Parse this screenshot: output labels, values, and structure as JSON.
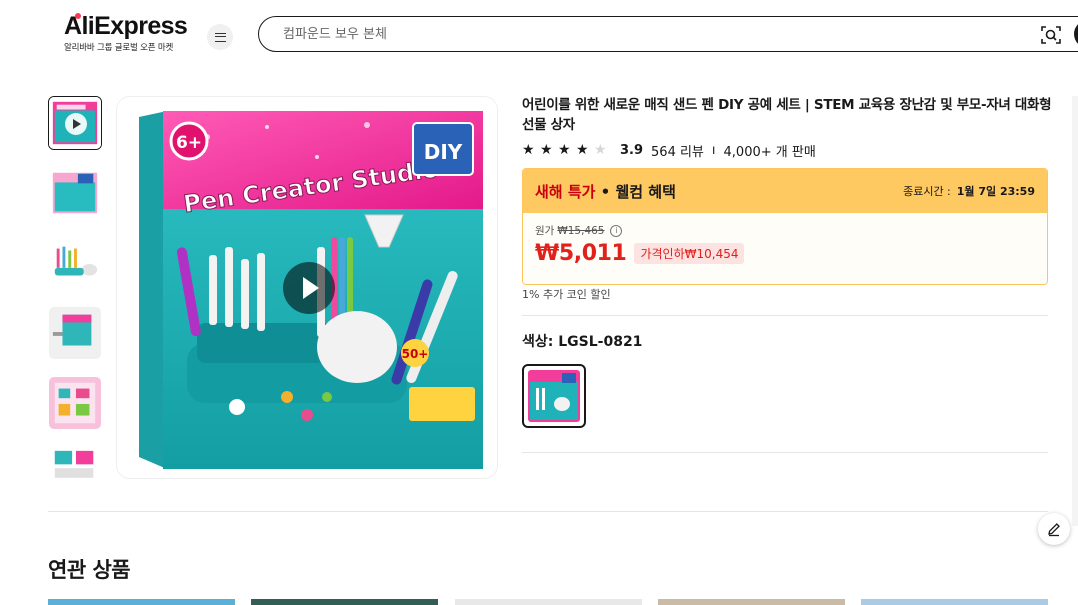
{
  "header": {
    "logo_text": "AliExpress",
    "logo_subtitle": "알리바바 그룹 글로벌 오픈 마켓",
    "search_placeholder": "컴파운드 보우 본체"
  },
  "product": {
    "title": "어린이를 위한 새로운 매직 샌드 펜 DIY 공예 세트 | STEM 교육용 장난감 및 부모-자녀 대화형 선물 상자",
    "rating": 3.9,
    "rating_display": "3.9",
    "reviews": "564 리뷰",
    "sold": "4,000+ 개 판매",
    "image_texts": {
      "age": "6+",
      "brand": "Pen Creator Studio",
      "diy": "DIY",
      "badge": "50+"
    }
  },
  "deal": {
    "title_red": "새해 특가",
    "title_rest": " • 웰컴 혜택",
    "end_label": "종료시간 :",
    "end_time": "1월 7일 23:59",
    "original_label": "원가",
    "original_price": "₩15,465",
    "price": "₩5,011",
    "discount": "가격인하₩10,454",
    "coin_note": "1% 추가 코인 할인"
  },
  "variant": {
    "label": "색상: LGSL-0821"
  },
  "related": {
    "title": "연관 상품"
  },
  "colors": {
    "accent_red": "#e0211c",
    "deal_header": "#ffc962",
    "box_teal": "#1fb2b8",
    "box_pink": "#f23d9a"
  }
}
